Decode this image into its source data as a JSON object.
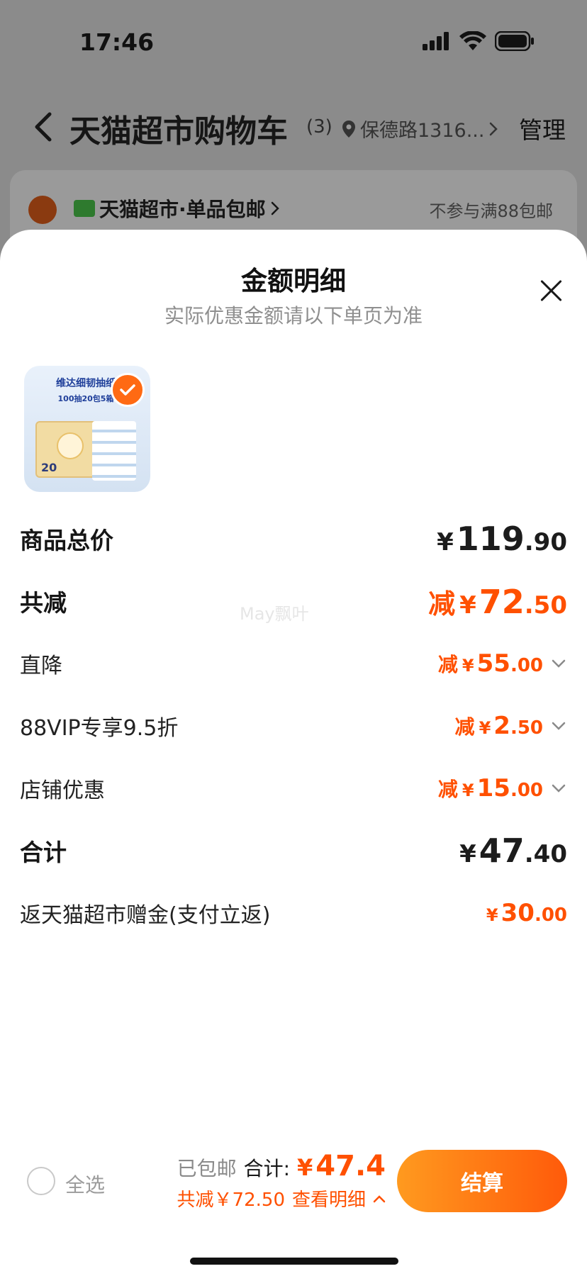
{
  "status_bar": {
    "time": "17:46"
  },
  "cart_header": {
    "title": "天猫超市购物车",
    "count": "(3)",
    "location": "保德路1316...",
    "manage": "管理"
  },
  "store_card": {
    "name": "天猫超市·单品包邮",
    "note": "不参与满88包邮"
  },
  "sheet": {
    "title": "金额明细",
    "subtitle": "实际优惠金额请以下单页为准",
    "product": {
      "line1": "维达细韧抽纸",
      "line2": "100抽20包5箱",
      "pack_label": "20",
      "selected": true
    },
    "rows": {
      "subtotal": {
        "label": "商品总价",
        "yen": "¥",
        "int": "119",
        "dec": ".90"
      },
      "total_discount": {
        "label": "共减",
        "minus": "减",
        "yen": "¥",
        "int": "72",
        "dec": ".50"
      },
      "direct_cut": {
        "label": "直降",
        "minus": "减",
        "yen": "¥",
        "int": "55",
        "dec": ".00"
      },
      "vip": {
        "label": "88VIP专享9.5折",
        "minus": "减",
        "yen": "¥",
        "int": "2",
        "dec": ".50"
      },
      "store_discount": {
        "label": "店铺优惠",
        "minus": "减",
        "yen": "¥",
        "int": "15",
        "dec": ".00"
      },
      "total": {
        "label": "合计",
        "yen": "¥",
        "int": "47",
        "dec": ".40"
      },
      "rebate": {
        "label": "返天猫超市赠金(支付立返)",
        "yen": "¥",
        "int": "30",
        "dec": ".00"
      }
    },
    "watermark": "May飘叶"
  },
  "footer": {
    "select_all": "全选",
    "free_shipping": "已包邮",
    "total_label": "合计:",
    "total_yen": "¥",
    "total_amount": "47.4",
    "discount_text": "共减￥72.50",
    "detail_link": "查看明细",
    "checkout": "结算"
  },
  "colors": {
    "accent": "#ff5000",
    "checkout_start": "#ff9a1f",
    "checkout_end": "#ff5a0a",
    "overlay": "#8b8b8b"
  }
}
